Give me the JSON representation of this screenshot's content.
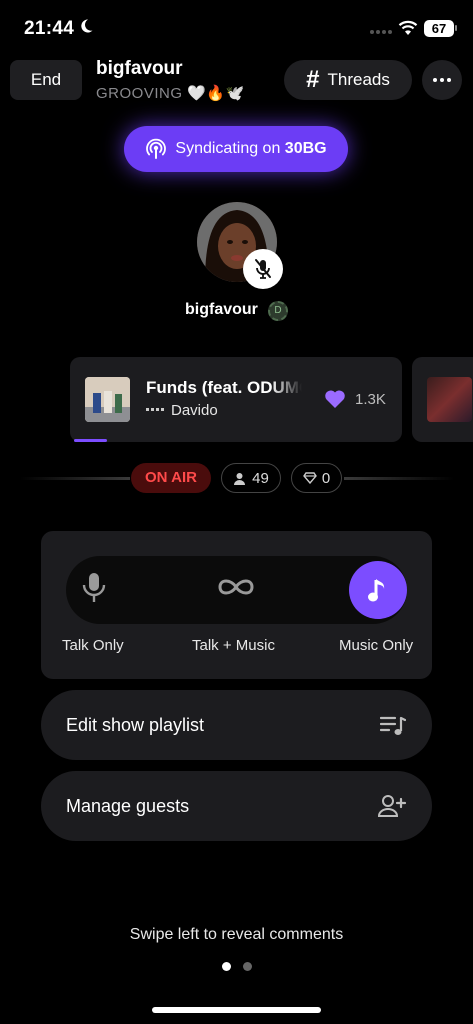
{
  "status_bar": {
    "time": "21:44",
    "battery": "67"
  },
  "header": {
    "end_label": "End",
    "host_name": "bigfavour",
    "host_status": "GROOVING 🤍🔥🕊️",
    "threads_label": "Threads",
    "more_label": "•••"
  },
  "syndicate": {
    "prefix": "Syndicating on ",
    "network": "30BG"
  },
  "speaker": {
    "name": "bigfavour",
    "verified_glyph": "D"
  },
  "now_playing": {
    "title": "Funds (feat. ODUMODUBLVCK)",
    "artist": "Davido",
    "likes": "1.3K",
    "progress": 0.1
  },
  "live": {
    "on_air_label": "ON AIR",
    "listeners": "49",
    "gems": "0"
  },
  "modes": {
    "talk_only": "Talk Only",
    "talk_music": "Talk + Music",
    "music_only": "Music Only",
    "selected": "music_only"
  },
  "actions": {
    "edit_playlist": "Edit show playlist",
    "manage_guests": "Manage guests"
  },
  "footer": {
    "swipe_hint": "Swipe left to reveal comments",
    "pages": 2,
    "active_page": 0
  },
  "colors": {
    "accent": "#7c4dff",
    "synd_bg": "#6c3df5",
    "on_air_text": "#ff4a4a",
    "on_air_bg": "#4a0c0c",
    "panel": "#1c1c1f"
  }
}
